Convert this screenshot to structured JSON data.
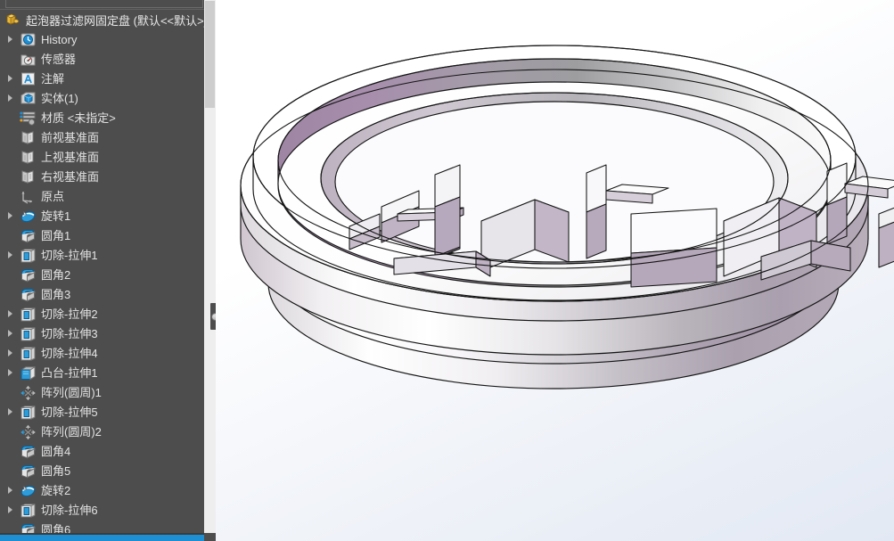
{
  "window": {
    "title": "起泡器过滤网固定盘  (默认<<默认>_显",
    "part_icon": "part-document-icon"
  },
  "feature_tree": {
    "panel_name": "FeatureManager design tree",
    "items": [
      {
        "label": "History",
        "icon": "history-icon",
        "has_arrow": true,
        "indent": 1
      },
      {
        "label": "传感器",
        "icon": "sensors-icon",
        "has_arrow": false,
        "indent": 1
      },
      {
        "label": "注解",
        "icon": "annotations-icon",
        "has_arrow": true,
        "indent": 1
      },
      {
        "label": "实体(1)",
        "icon": "solid-bodies-icon",
        "has_arrow": true,
        "indent": 1
      },
      {
        "label": "材质 <未指定>",
        "icon": "material-icon",
        "has_arrow": false,
        "indent": 1
      },
      {
        "label": "前视基准面",
        "icon": "plane-icon",
        "has_arrow": false,
        "indent": 1
      },
      {
        "label": "上视基准面",
        "icon": "plane-icon",
        "has_arrow": false,
        "indent": 1
      },
      {
        "label": "右视基准面",
        "icon": "plane-icon",
        "has_arrow": false,
        "indent": 1
      },
      {
        "label": "原点",
        "icon": "origin-icon",
        "has_arrow": false,
        "indent": 1
      },
      {
        "label": "旋转1",
        "icon": "revolve-icon",
        "has_arrow": true,
        "indent": 1
      },
      {
        "label": "圆角1",
        "icon": "fillet-icon",
        "has_arrow": false,
        "indent": 1
      },
      {
        "label": "切除-拉伸1",
        "icon": "cut-extrude-icon",
        "has_arrow": true,
        "indent": 1
      },
      {
        "label": "圆角2",
        "icon": "fillet-icon",
        "has_arrow": false,
        "indent": 1
      },
      {
        "label": "圆角3",
        "icon": "fillet-icon",
        "has_arrow": false,
        "indent": 1
      },
      {
        "label": "切除-拉伸2",
        "icon": "cut-extrude-icon",
        "has_arrow": true,
        "indent": 1
      },
      {
        "label": "切除-拉伸3",
        "icon": "cut-extrude-icon",
        "has_arrow": true,
        "indent": 1
      },
      {
        "label": "切除-拉伸4",
        "icon": "cut-extrude-icon",
        "has_arrow": true,
        "indent": 1
      },
      {
        "label": "凸台-拉伸1",
        "icon": "boss-extrude-icon",
        "has_arrow": true,
        "indent": 1
      },
      {
        "label": "阵列(圆周)1",
        "icon": "circular-pattern-icon",
        "has_arrow": false,
        "indent": 1
      },
      {
        "label": "切除-拉伸5",
        "icon": "cut-extrude-icon",
        "has_arrow": true,
        "indent": 1
      },
      {
        "label": "阵列(圆周)2",
        "icon": "circular-pattern-icon",
        "has_arrow": false,
        "indent": 1
      },
      {
        "label": "圆角4",
        "icon": "fillet-icon",
        "has_arrow": false,
        "indent": 1
      },
      {
        "label": "圆角5",
        "icon": "fillet-icon",
        "has_arrow": false,
        "indent": 1
      },
      {
        "label": "旋转2",
        "icon": "revolve-icon",
        "has_arrow": true,
        "indent": 1
      },
      {
        "label": "切除-拉伸6",
        "icon": "cut-extrude-icon",
        "has_arrow": true,
        "indent": 1
      },
      {
        "label": "圆角6",
        "icon": "fillet-icon",
        "has_arrow": false,
        "indent": 1
      }
    ]
  },
  "graphics": {
    "model_name": "起泡器过滤网固定盘",
    "view": "isometric-shaded-with-edges",
    "background_top_color": "#ffffff",
    "background_bottom_color": "#e3e9f4",
    "material_light_color": "#f2f0f3",
    "material_shadow_color": "#a38ea6",
    "material_mid_color": "#b9b9bd",
    "edge_color": "#1a1a1a"
  },
  "colors": {
    "panel_bg": "#4d4d4d",
    "panel_text": "#e3e3e3",
    "scrollbar_accent": "#1f8fd4",
    "icon_blue": "#1f8fd4"
  }
}
